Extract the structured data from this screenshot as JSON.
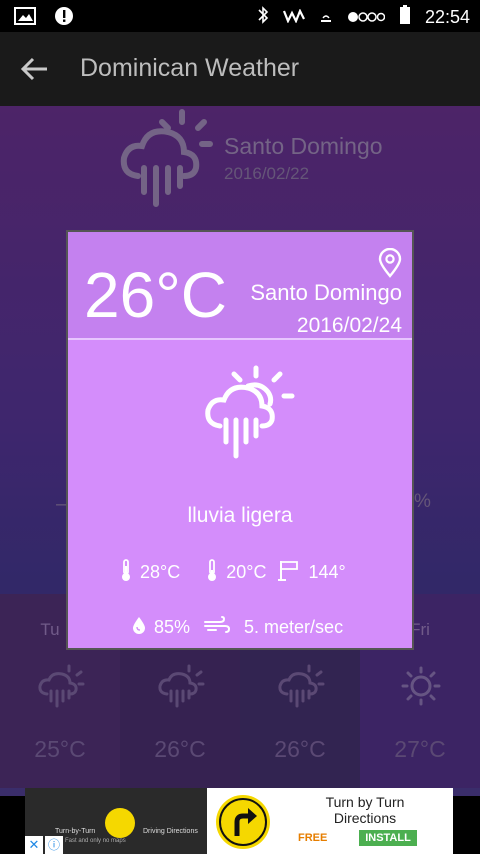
{
  "status_bar": {
    "time": "22:54",
    "icons": [
      "image-icon",
      "alert-icon",
      "bluetooth-icon",
      "signal-icon",
      "silent-icon",
      "network-dots-icon",
      "battery-icon"
    ]
  },
  "app_bar": {
    "title": "Dominican Weather",
    "back_icon": "arrow-left-icon"
  },
  "background": {
    "city": "Santo Domingo",
    "date": "2016/02/22",
    "percent_partial": "%",
    "dash_partial": "–",
    "forecast": [
      {
        "day": "Tu",
        "icon": "cloud-rain-icon",
        "temp": "25°C"
      },
      {
        "day": "",
        "icon": "cloud-rain-icon",
        "temp": "26°C"
      },
      {
        "day": "",
        "icon": "cloud-rain-icon",
        "temp": "26°C"
      },
      {
        "day": "Fri",
        "icon": "sun-icon",
        "temp": "27°C"
      }
    ]
  },
  "dialog": {
    "temperature": "26°C",
    "city": "Santo Domingo",
    "date": "2016/02/24",
    "location_icon": "location-pin-icon",
    "weather_icon": "sun-cloud-rain-icon",
    "description": "lluvia ligera",
    "max_temp": "28°C",
    "min_temp": "20°C",
    "wind_direction": "144°",
    "humidity": "85%",
    "wind_speed": "5. meter/sec"
  },
  "ad": {
    "left_line1": "Turn-by-Turn",
    "left_line2": "Driving Directions",
    "left_line3": "Fast  and only  no maps",
    "title": "Turn by Turn Directions",
    "free_label": "FREE",
    "install_label": "INSTALL",
    "close_glyph": "✕",
    "info_glyph": "ⓘ"
  },
  "colors": {
    "dialog_header": "#c481ef",
    "dialog_body": "#d48dfb",
    "background_top": "#5e2d7f",
    "app_bar": "#1a1a1a"
  }
}
